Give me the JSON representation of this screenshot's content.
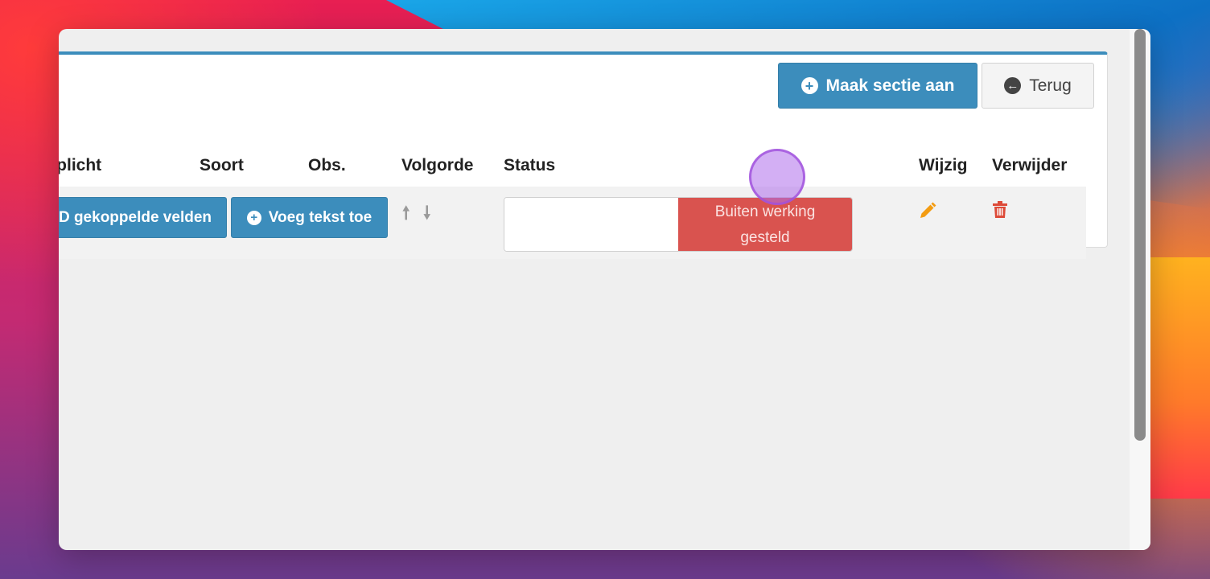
{
  "toolbar": {
    "create_section_label": "Maak sectie aan",
    "back_label": "Terug"
  },
  "table": {
    "headers": {
      "verplicht": "rplicht",
      "soort": "Soort",
      "obs": "Obs.",
      "volgorde": "Volgorde",
      "status": "Status",
      "wijzig": "Wijzig",
      "verwijder": "Verwijder"
    },
    "row": {
      "linked_fields_label": "D gekoppelde velden",
      "add_text_label": "Voeg tekst toe",
      "status_off_line1": "Buiten werking",
      "status_off_line2": "gesteld"
    }
  },
  "icons": {
    "plus": "plus-circle-icon",
    "back": "arrow-left-circle-icon",
    "up": "arrow-up-icon",
    "down": "arrow-down-icon",
    "edit": "pencil-icon",
    "delete": "trash-icon"
  },
  "colors": {
    "primary": "#3c8dbc",
    "danger": "#d9534f",
    "edit": "#f39c12",
    "delete": "#dd4b39"
  }
}
